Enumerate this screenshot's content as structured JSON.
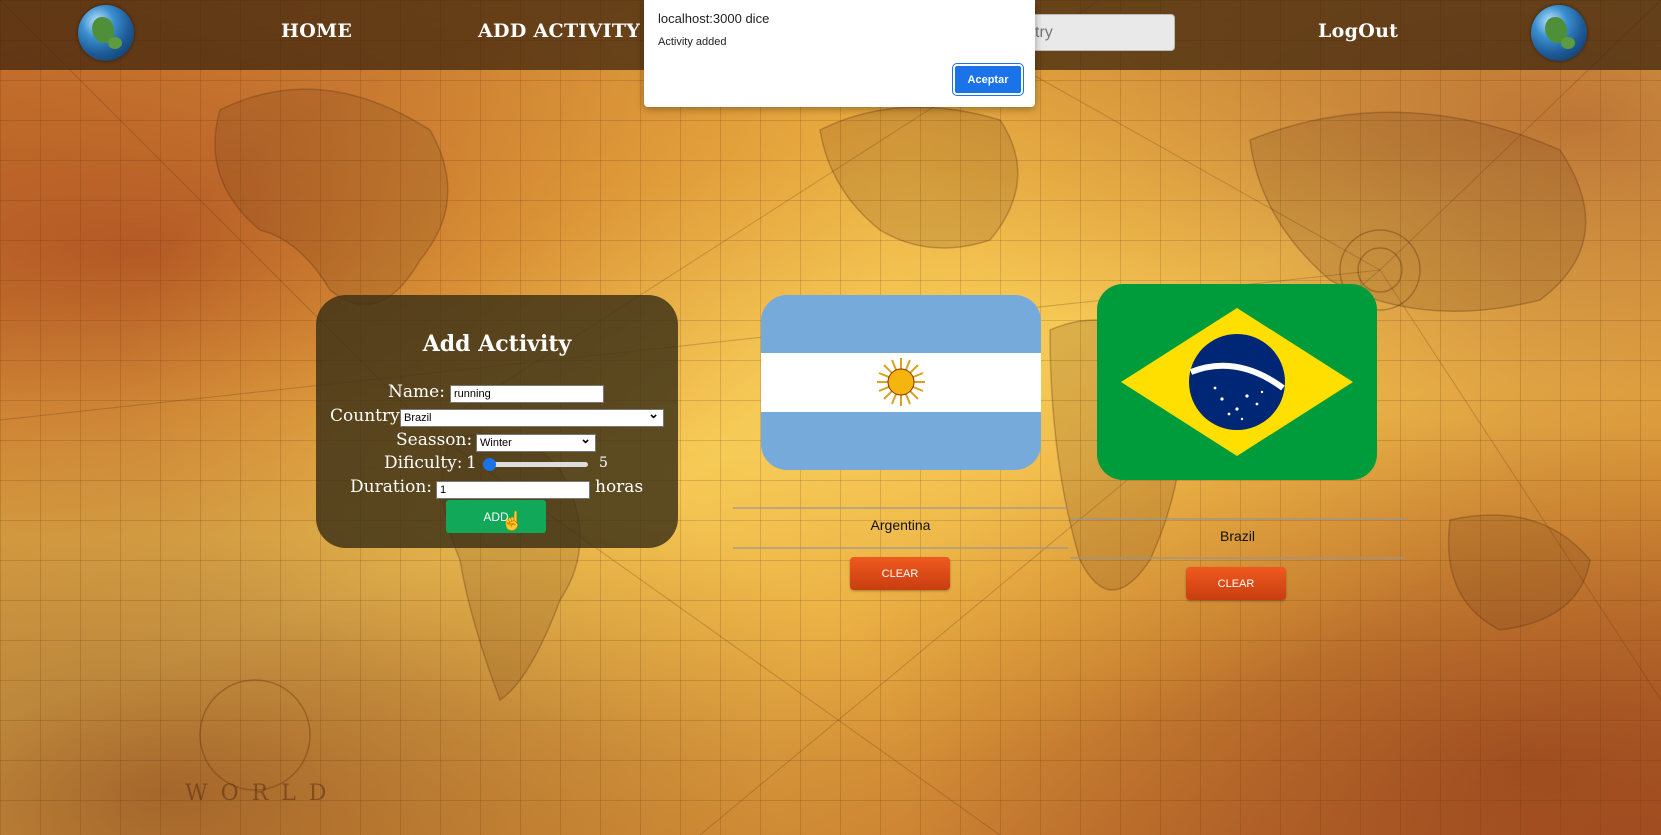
{
  "nav": {
    "home_label": "HOME",
    "add_activity_label": "ADD ACTIVITY",
    "search_placeholder": "try",
    "logout_label": "LogOut"
  },
  "dialog": {
    "title": "localhost:3000 dice",
    "message": "Activity added",
    "button_label": "Aceptar"
  },
  "form": {
    "title": "Add Activity",
    "name_label": "Name:",
    "name_value": "running",
    "country_label": "Country",
    "country_value": "Brazil",
    "season_label": "Seasson:",
    "season_value": "Winter",
    "difficulty_label": "Dificulty:",
    "difficulty_min": "1",
    "difficulty_max": "5",
    "difficulty_value": 1,
    "duration_label": "Duration:",
    "duration_value": "1",
    "duration_unit": "horas",
    "add_label": "ADD"
  },
  "countries": [
    {
      "name": "Argentina",
      "clear_label": "CLEAR"
    },
    {
      "name": "Brazil",
      "clear_label": "CLEAR"
    }
  ],
  "colors": {
    "nav_bg": "#3c230c",
    "add_button": "#12a85a",
    "clear_button": "#e04e18",
    "dialog_button": "#1a73e8",
    "argentina_blue": "#75aadb",
    "brazil_green": "#009c3b",
    "brazil_yellow": "#fedf00",
    "brazil_blue": "#002776"
  }
}
